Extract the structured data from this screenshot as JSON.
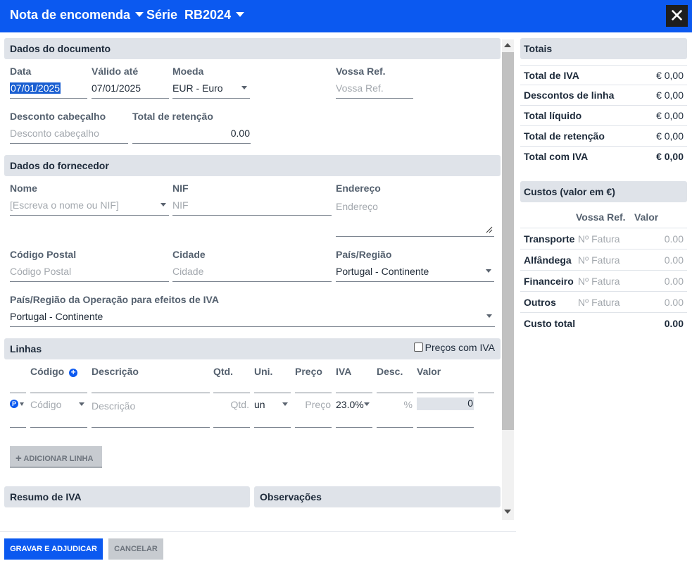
{
  "header": {
    "title": "Nota de encomenda",
    "serie": "Série  RB2024",
    "close_glyph": "✕"
  },
  "documento": {
    "section": "Dados do documento",
    "data_label": "Data",
    "data_value": "07/01/2025",
    "valido_label": "Válido até",
    "valido_value": "07/01/2025",
    "moeda_label": "Moeda",
    "moeda_value": "EUR - Euro",
    "ref_label": "Vossa Ref.",
    "ref_placeholder": "Vossa Ref.",
    "desconto_label": "Desconto cabeçalho",
    "desconto_placeholder": "Desconto cabeçalho",
    "retencao_label": "Total de retenção",
    "retencao_value": "0.00"
  },
  "fornecedor": {
    "section": "Dados do fornecedor",
    "nome_label": "Nome",
    "nome_placeholder": "[Escreva o nome ou NIF]",
    "nif_label": "NIF",
    "nif_placeholder": "NIF",
    "endereco_label": "Endereço",
    "endereco_placeholder": "Endereço",
    "cp_label": "Código Postal",
    "cp_placeholder": "Código Postal",
    "cidade_label": "Cidade",
    "cidade_placeholder": "Cidade",
    "pais_label": "País/Região",
    "pais_value": "Portugal - Continente",
    "pais_iva_label": "País/Região da Operação para efeitos de IVA",
    "pais_iva_value": "Portugal - Continente"
  },
  "linhas": {
    "section": "Linhas",
    "precos_iva_label": "Preços com IVA",
    "columns": [
      "Código",
      "Descrição",
      "Qtd.",
      "Uni.",
      "Preço",
      "IVA",
      "Desc.",
      "Valor"
    ],
    "row": {
      "badge": "P",
      "codigo_placeholder": "Código",
      "descricao_placeholder": "Descrição",
      "qtd_placeholder": "Qtd.",
      "uni_value": "un",
      "preco_placeholder": "Preço",
      "iva_value": "23.0%",
      "desc_placeholder": "%",
      "valor_value": "0"
    },
    "add_button": "ADICIONAR LINHA"
  },
  "resumo_iva": {
    "section": "Resumo de IVA"
  },
  "observacoes": {
    "section": "Observações"
  },
  "footer": {
    "save": "GRAVAR E ADJUDICAR",
    "cancel": "CANCELAR"
  },
  "totais": {
    "section": "Totais",
    "rows": [
      {
        "label": "Total de IVA",
        "value": "€ 0,00"
      },
      {
        "label": "Descontos de linha",
        "value": "€ 0,00"
      },
      {
        "label": "Total líquido",
        "value": "€ 0,00"
      },
      {
        "label": "Total de retenção",
        "value": "€ 0,00"
      },
      {
        "label": "Total com IVA",
        "value": "€ 0,00"
      }
    ]
  },
  "custos": {
    "section": "Custos (valor em €)",
    "col_ref": "Vossa Ref.",
    "col_valor": "Valor",
    "rows": [
      {
        "label": "Transporte",
        "ref_placeholder": "Nº Fatura",
        "value": "0.00"
      },
      {
        "label": "Alfândega",
        "ref_placeholder": "Nº Fatura",
        "value": "0.00"
      },
      {
        "label": "Financeiro",
        "ref_placeholder": "Nº Fatura",
        "value": "0.00"
      },
      {
        "label": "Outros",
        "ref_placeholder": "Nº Fatura",
        "value": "0.00"
      }
    ],
    "total_label": "Custo total",
    "total_value": "0.00"
  }
}
